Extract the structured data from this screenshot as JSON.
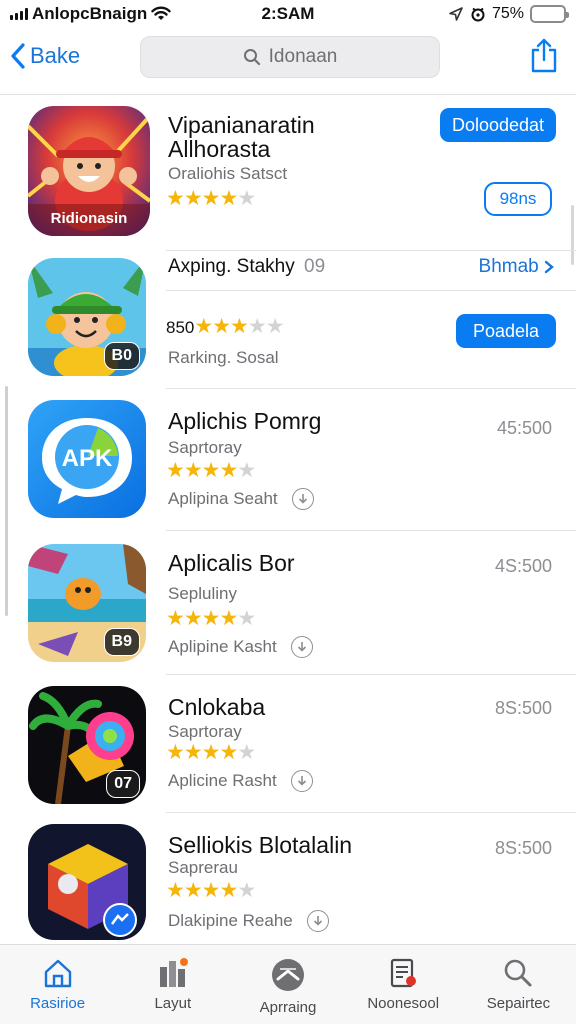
{
  "status_bar": {
    "carrier": "AnlopcBnaign",
    "time": "2:SAM",
    "battery": "75%",
    "battery_level": 1.0,
    "battery_color": "#34c759"
  },
  "nav": {
    "back_label": "Bake",
    "search_value": "Idonaan",
    "accent": "#0a7cf2"
  },
  "apps": [
    {
      "title_line1": "Vipanianaratin",
      "title_line2": "Allhorasta",
      "subtitle": "Oraliohis Satsct",
      "rating": 4,
      "primary_button": "Doloodedat",
      "secondary_button": "98ns",
      "icon_text": "Ridionasin",
      "icon_name": "cartoon-boy-icon"
    },
    {
      "title": "Axping. Stakhy",
      "title_suffix": "09",
      "rating_prefix": "850",
      "rating": 3,
      "subtitle": "Rarking. Sosal",
      "link_button": "Bhmab",
      "primary_button": "Poadela",
      "badge": "B0",
      "icon_name": "green-cap-kid-icon"
    },
    {
      "title": "Aplichis Pomrg",
      "subtitle": "Saprtoray",
      "rating": 4,
      "meta": "Aplipina Seaht",
      "price": "45:500",
      "icon_text": "APK",
      "icon_name": "apk-chat-icon"
    },
    {
      "title": "Aplicalis Bor",
      "subtitle": "Sepluliny",
      "rating": 4,
      "meta": "Aplipine Kasht",
      "price": "4S:500",
      "badge": "B9",
      "icon_name": "beach-fish-icon"
    },
    {
      "title": "Cnlokaba",
      "subtitle": "Saprtoray",
      "rating": 4,
      "meta": "Aplicine Rasht",
      "price": "8S:500",
      "badge": "07",
      "icon_name": "palm-lens-icon"
    },
    {
      "title": "Selliokis Blotalalin",
      "subtitle": "Saprerau",
      "rating": 4,
      "meta": "Dlakipine Reahe",
      "price": "8S:500",
      "icon_name": "cube-messenger-icon"
    }
  ],
  "tabs": [
    {
      "label": "Rasirioe",
      "icon": "home-icon",
      "active": true
    },
    {
      "label": "Layut",
      "icon": "apps-icon",
      "active": false
    },
    {
      "label": "Aprraing",
      "icon": "games-icon",
      "active": false
    },
    {
      "label": "Noonesool",
      "icon": "news-icon",
      "active": false
    },
    {
      "label": "Sepairtec",
      "icon": "search-icon",
      "active": false
    }
  ]
}
